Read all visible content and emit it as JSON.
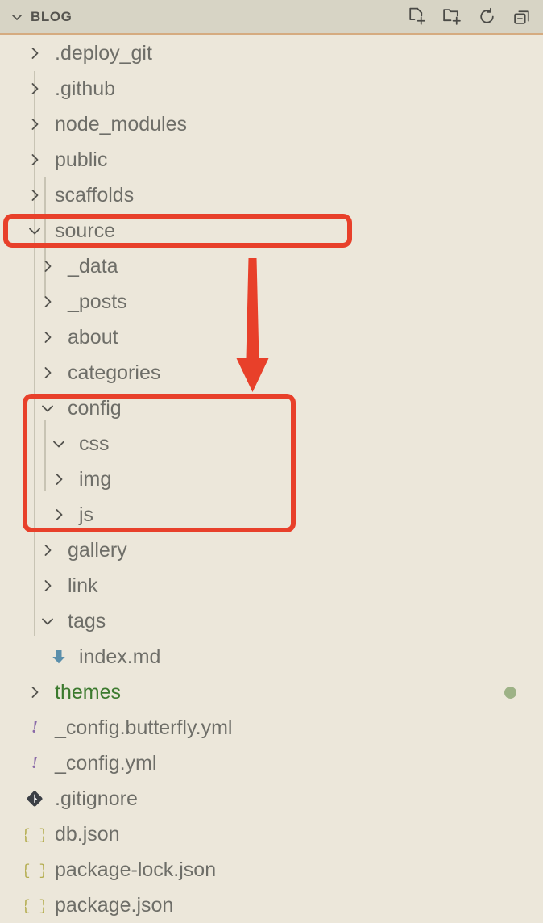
{
  "header": {
    "title": "BLOG",
    "chevron_icon": "chevron-down-icon",
    "actions": [
      {
        "name": "new-file-button",
        "icon": "new-file-icon",
        "label": "New File"
      },
      {
        "name": "new-folder-button",
        "icon": "new-folder-icon",
        "label": "New Folder"
      },
      {
        "name": "refresh-button",
        "icon": "refresh-icon",
        "label": "Refresh Explorer"
      },
      {
        "name": "collapse-all-button",
        "icon": "collapse-all-icon",
        "label": "Collapse Folders in Explorer"
      }
    ]
  },
  "tree": [
    {
      "label": ".deploy_git",
      "level": 1,
      "type": "folder",
      "state": "collapsed"
    },
    {
      "label": ".github",
      "level": 1,
      "type": "folder",
      "state": "collapsed"
    },
    {
      "label": "node_modules",
      "level": 1,
      "type": "folder",
      "state": "collapsed"
    },
    {
      "label": "public",
      "level": 1,
      "type": "folder",
      "state": "collapsed"
    },
    {
      "label": "scaffolds",
      "level": 1,
      "type": "folder",
      "state": "collapsed"
    },
    {
      "label": "source",
      "level": 1,
      "type": "folder",
      "state": "expanded"
    },
    {
      "label": "_data",
      "level": 2,
      "type": "folder",
      "state": "collapsed"
    },
    {
      "label": "_posts",
      "level": 2,
      "type": "folder",
      "state": "collapsed"
    },
    {
      "label": "about",
      "level": 2,
      "type": "folder",
      "state": "collapsed"
    },
    {
      "label": "categories",
      "level": 2,
      "type": "folder",
      "state": "collapsed"
    },
    {
      "label": "config",
      "level": 2,
      "type": "folder",
      "state": "expanded"
    },
    {
      "label": "css",
      "level": 3,
      "type": "folder",
      "state": "expanded"
    },
    {
      "label": "img",
      "level": 3,
      "type": "folder",
      "state": "collapsed"
    },
    {
      "label": "js",
      "level": 3,
      "type": "folder",
      "state": "collapsed"
    },
    {
      "label": "gallery",
      "level": 2,
      "type": "folder",
      "state": "collapsed"
    },
    {
      "label": "link",
      "level": 2,
      "type": "folder",
      "state": "collapsed"
    },
    {
      "label": "tags",
      "level": 2,
      "type": "folder",
      "state": "expanded"
    },
    {
      "label": "index.md",
      "level": 3,
      "type": "file",
      "icon": "markdown-icon"
    },
    {
      "label": "themes",
      "level": 1,
      "type": "folder",
      "state": "collapsed",
      "git_status": "modified",
      "badge_dot": true
    },
    {
      "label": "_config.butterfly.yml",
      "level": 1,
      "type": "file",
      "icon": "yaml-icon"
    },
    {
      "label": "_config.yml",
      "level": 1,
      "type": "file",
      "icon": "yaml-icon"
    },
    {
      "label": ".gitignore",
      "level": 1,
      "type": "file",
      "icon": "git-icon"
    },
    {
      "label": "db.json",
      "level": 1,
      "type": "file",
      "icon": "json-icon"
    },
    {
      "label": "package-lock.json",
      "level": 1,
      "type": "file",
      "icon": "json-icon"
    },
    {
      "label": "package.json",
      "level": 1,
      "type": "file",
      "icon": "json-icon"
    }
  ],
  "annotations": {
    "source_highlight": {
      "target": "source",
      "shape": "rounded-rectangle"
    },
    "config_highlight": {
      "target": "config",
      "shape": "rounded-rectangle"
    },
    "arrow": {
      "direction": "down",
      "from": "source",
      "to": "config"
    }
  },
  "colors": {
    "header_bg": "#d7d4c5",
    "header_rule": "#d5ab80",
    "body_bg": "#ece7da",
    "text": "#6e6e68",
    "annotation_red": "#e8402a",
    "git_modified_green": "#3c7a2e",
    "badge_dot_green": "#9db286",
    "markdown_blue": "#5b8fab",
    "yaml_purple": "#8a6aa8",
    "json_olive": "#b5ae52",
    "git_icon_dark": "#3b3f45"
  }
}
